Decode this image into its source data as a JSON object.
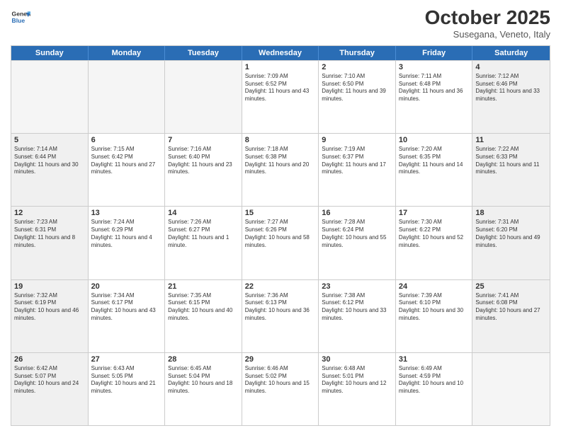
{
  "header": {
    "logo_general": "General",
    "logo_blue": "Blue",
    "month": "October 2025",
    "location": "Susegana, Veneto, Italy"
  },
  "weekdays": [
    "Sunday",
    "Monday",
    "Tuesday",
    "Wednesday",
    "Thursday",
    "Friday",
    "Saturday"
  ],
  "rows": [
    [
      {
        "day": "",
        "info": "",
        "empty": true
      },
      {
        "day": "",
        "info": "",
        "empty": true
      },
      {
        "day": "",
        "info": "",
        "empty": true
      },
      {
        "day": "1",
        "info": "Sunrise: 7:09 AM\nSunset: 6:52 PM\nDaylight: 11 hours and 43 minutes.",
        "empty": false
      },
      {
        "day": "2",
        "info": "Sunrise: 7:10 AM\nSunset: 6:50 PM\nDaylight: 11 hours and 39 minutes.",
        "empty": false
      },
      {
        "day": "3",
        "info": "Sunrise: 7:11 AM\nSunset: 6:48 PM\nDaylight: 11 hours and 36 minutes.",
        "empty": false
      },
      {
        "day": "4",
        "info": "Sunrise: 7:12 AM\nSunset: 6:46 PM\nDaylight: 11 hours and 33 minutes.",
        "empty": false,
        "shaded": true
      }
    ],
    [
      {
        "day": "5",
        "info": "Sunrise: 7:14 AM\nSunset: 6:44 PM\nDaylight: 11 hours and 30 minutes.",
        "empty": false,
        "shaded": true
      },
      {
        "day": "6",
        "info": "Sunrise: 7:15 AM\nSunset: 6:42 PM\nDaylight: 11 hours and 27 minutes.",
        "empty": false
      },
      {
        "day": "7",
        "info": "Sunrise: 7:16 AM\nSunset: 6:40 PM\nDaylight: 11 hours and 23 minutes.",
        "empty": false
      },
      {
        "day": "8",
        "info": "Sunrise: 7:18 AM\nSunset: 6:38 PM\nDaylight: 11 hours and 20 minutes.",
        "empty": false
      },
      {
        "day": "9",
        "info": "Sunrise: 7:19 AM\nSunset: 6:37 PM\nDaylight: 11 hours and 17 minutes.",
        "empty": false
      },
      {
        "day": "10",
        "info": "Sunrise: 7:20 AM\nSunset: 6:35 PM\nDaylight: 11 hours and 14 minutes.",
        "empty": false
      },
      {
        "day": "11",
        "info": "Sunrise: 7:22 AM\nSunset: 6:33 PM\nDaylight: 11 hours and 11 minutes.",
        "empty": false,
        "shaded": true
      }
    ],
    [
      {
        "day": "12",
        "info": "Sunrise: 7:23 AM\nSunset: 6:31 PM\nDaylight: 11 hours and 8 minutes.",
        "empty": false,
        "shaded": true
      },
      {
        "day": "13",
        "info": "Sunrise: 7:24 AM\nSunset: 6:29 PM\nDaylight: 11 hours and 4 minutes.",
        "empty": false
      },
      {
        "day": "14",
        "info": "Sunrise: 7:26 AM\nSunset: 6:27 PM\nDaylight: 11 hours and 1 minute.",
        "empty": false
      },
      {
        "day": "15",
        "info": "Sunrise: 7:27 AM\nSunset: 6:26 PM\nDaylight: 10 hours and 58 minutes.",
        "empty": false
      },
      {
        "day": "16",
        "info": "Sunrise: 7:28 AM\nSunset: 6:24 PM\nDaylight: 10 hours and 55 minutes.",
        "empty": false
      },
      {
        "day": "17",
        "info": "Sunrise: 7:30 AM\nSunset: 6:22 PM\nDaylight: 10 hours and 52 minutes.",
        "empty": false
      },
      {
        "day": "18",
        "info": "Sunrise: 7:31 AM\nSunset: 6:20 PM\nDaylight: 10 hours and 49 minutes.",
        "empty": false,
        "shaded": true
      }
    ],
    [
      {
        "day": "19",
        "info": "Sunrise: 7:32 AM\nSunset: 6:19 PM\nDaylight: 10 hours and 46 minutes.",
        "empty": false,
        "shaded": true
      },
      {
        "day": "20",
        "info": "Sunrise: 7:34 AM\nSunset: 6:17 PM\nDaylight: 10 hours and 43 minutes.",
        "empty": false
      },
      {
        "day": "21",
        "info": "Sunrise: 7:35 AM\nSunset: 6:15 PM\nDaylight: 10 hours and 40 minutes.",
        "empty": false
      },
      {
        "day": "22",
        "info": "Sunrise: 7:36 AM\nSunset: 6:13 PM\nDaylight: 10 hours and 36 minutes.",
        "empty": false
      },
      {
        "day": "23",
        "info": "Sunrise: 7:38 AM\nSunset: 6:12 PM\nDaylight: 10 hours and 33 minutes.",
        "empty": false
      },
      {
        "day": "24",
        "info": "Sunrise: 7:39 AM\nSunset: 6:10 PM\nDaylight: 10 hours and 30 minutes.",
        "empty": false
      },
      {
        "day": "25",
        "info": "Sunrise: 7:41 AM\nSunset: 6:08 PM\nDaylight: 10 hours and 27 minutes.",
        "empty": false,
        "shaded": true
      }
    ],
    [
      {
        "day": "26",
        "info": "Sunrise: 6:42 AM\nSunset: 5:07 PM\nDaylight: 10 hours and 24 minutes.",
        "empty": false,
        "shaded": true
      },
      {
        "day": "27",
        "info": "Sunrise: 6:43 AM\nSunset: 5:05 PM\nDaylight: 10 hours and 21 minutes.",
        "empty": false
      },
      {
        "day": "28",
        "info": "Sunrise: 6:45 AM\nSunset: 5:04 PM\nDaylight: 10 hours and 18 minutes.",
        "empty": false
      },
      {
        "day": "29",
        "info": "Sunrise: 6:46 AM\nSunset: 5:02 PM\nDaylight: 10 hours and 15 minutes.",
        "empty": false
      },
      {
        "day": "30",
        "info": "Sunrise: 6:48 AM\nSunset: 5:01 PM\nDaylight: 10 hours and 12 minutes.",
        "empty": false
      },
      {
        "day": "31",
        "info": "Sunrise: 6:49 AM\nSunset: 4:59 PM\nDaylight: 10 hours and 10 minutes.",
        "empty": false
      },
      {
        "day": "",
        "info": "",
        "empty": true,
        "shaded": true
      }
    ]
  ]
}
